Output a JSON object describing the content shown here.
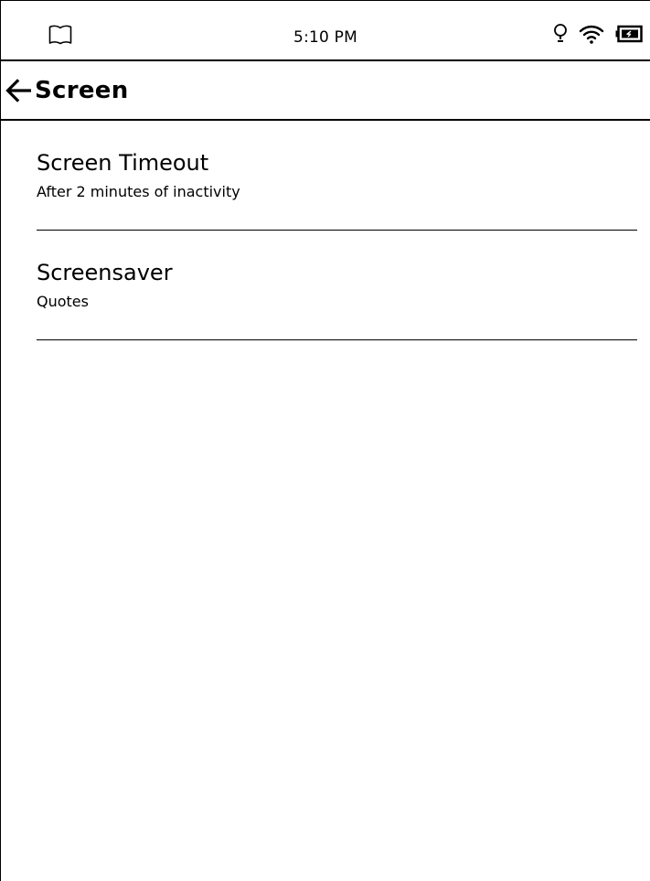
{
  "status_bar": {
    "time": "5:10 PM",
    "icons": [
      "book-icon",
      "lightbulb-icon",
      "wifi-icon",
      "battery-charging-icon"
    ]
  },
  "header": {
    "back_icon": "arrow-left-icon",
    "title": "Screen"
  },
  "settings": {
    "items": [
      {
        "title": "Screen Timeout",
        "subtitle": "After 2 minutes of inactivity"
      },
      {
        "title": "Screensaver",
        "subtitle": "Quotes"
      }
    ]
  },
  "colors": {
    "background": "#ffffff",
    "foreground": "#000000"
  }
}
